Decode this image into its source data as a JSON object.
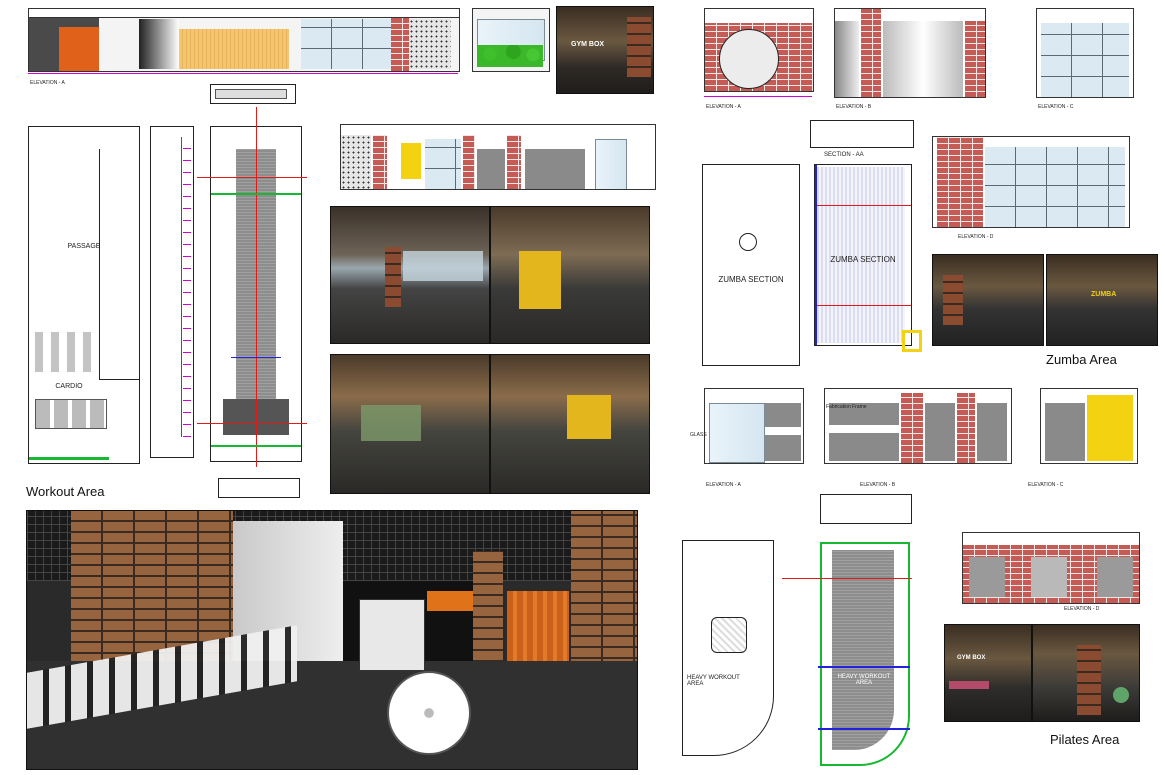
{
  "workout": {
    "elevation_a_label": "ELEVATION - A",
    "passage_label": "PASSAGE",
    "cardio_label": "CARDIO",
    "caption": "Workout Area",
    "photo_sign": "GYM BOX"
  },
  "zumba": {
    "elevation_a_label": "ELEVATION - A",
    "elevation_b_label": "ELEVATION - B",
    "elevation_c_label": "ELEVATION - C",
    "elevation_d_label": "ELEVATION - D",
    "section_label": "SECTION - AA",
    "plan_label": "ZUMBA SECTION",
    "plan_label_2": "ZUMBA SECTION",
    "caption": "Zumba Area",
    "photo_sign": "ZUMBA"
  },
  "zumba_lower": {
    "elevation_a_label": "ELEVATION - A",
    "elevation_b_label": "ELEVATION - B",
    "elevation_c_label": "ELEVATION - C",
    "glass_label": "GLASS",
    "fabric_label": "Fabrication Frame"
  },
  "pilates": {
    "plan_label": "HEAVY WORKOUT AREA",
    "plan_label_2": "HEAVY WORKOUT AREA",
    "elevation_d_label": "ELEVATION - D",
    "caption": "Pilates Area",
    "photo_sign": "GYM BOX"
  },
  "colors": {
    "dimension": "#d100d1",
    "grid_line": "#e01b1b",
    "brick": "#c65a55",
    "accent_yellow": "#f3d211",
    "plan_green": "#19b832",
    "plan_blue": "#2222dd"
  }
}
